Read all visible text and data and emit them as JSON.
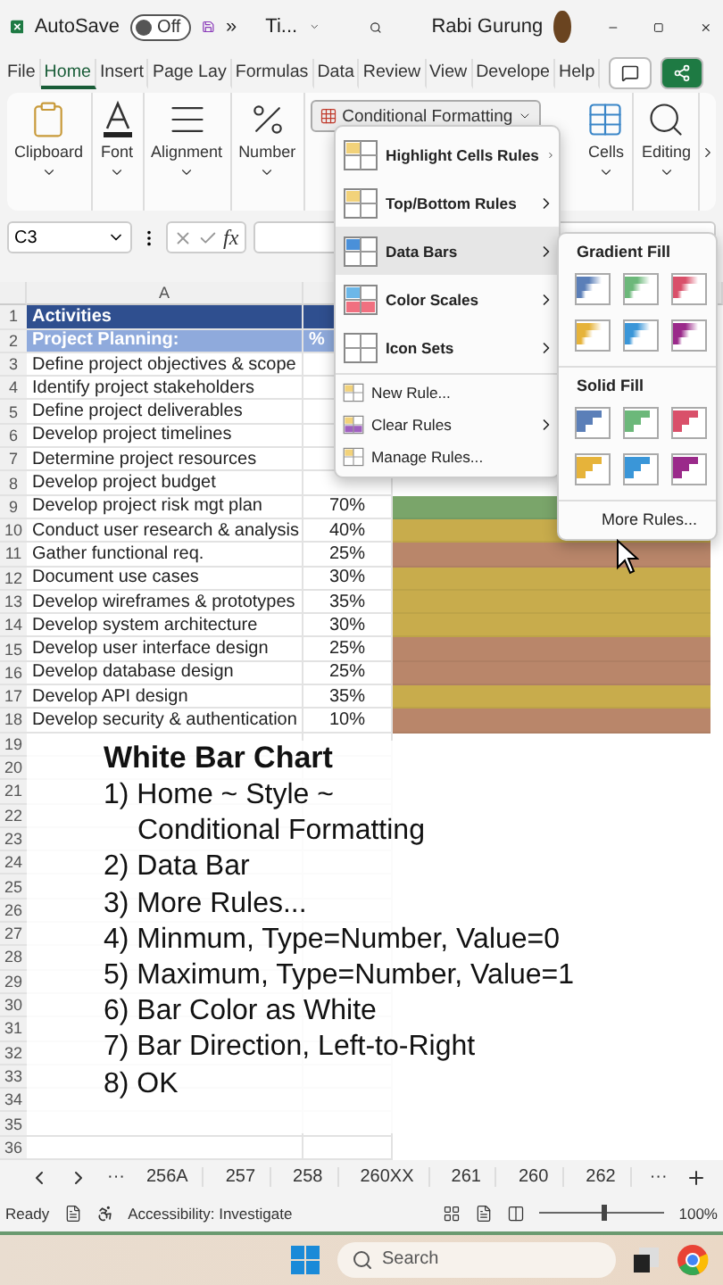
{
  "title_bar": {
    "autosave_label": "AutoSave",
    "autosave_on": false,
    "autosave_state": "Off",
    "more": "»",
    "file_name": "Ti...",
    "user": "Rabi Gurung"
  },
  "tabs": [
    {
      "label": "File",
      "selected": false
    },
    {
      "label": "Home",
      "selected": true
    },
    {
      "label": "Insert",
      "selected": false
    },
    {
      "label": "Page Lay",
      "selected": false
    },
    {
      "label": "Formulas",
      "selected": false
    },
    {
      "label": "Data",
      "selected": false
    },
    {
      "label": "Review",
      "selected": false
    },
    {
      "label": "View",
      "selected": false
    },
    {
      "label": "Develope",
      "selected": false
    },
    {
      "label": "Help",
      "selected": false
    }
  ],
  "ribbon": {
    "groups_left": [
      {
        "label": "Clipboard",
        "kind": "clipboard"
      },
      {
        "label": "Font",
        "kind": "font"
      },
      {
        "label": "Alignment",
        "kind": "alignment"
      },
      {
        "label": "Number",
        "kind": "number"
      }
    ],
    "conditional_formatting": "Conditional Formatting",
    "groups_right": [
      {
        "label": "Cells",
        "kind": "cells"
      },
      {
        "label": "Editing",
        "kind": "editing"
      }
    ]
  },
  "formula_bar": {
    "name_box": "C3",
    "fx": "fx"
  },
  "sheet": {
    "column_a": "A",
    "rows": [
      {
        "num": "1",
        "kind": "title",
        "activity": "Activities"
      },
      {
        "num": "2",
        "kind": "section",
        "activity": "Project Planning:",
        "percent": "%"
      },
      {
        "num": "3",
        "kind": "task",
        "activity": "Define project objectives & scope"
      },
      {
        "num": "4",
        "kind": "task",
        "activity": "Identify project stakeholders"
      },
      {
        "num": "5",
        "kind": "task",
        "activity": "Define project deliverables"
      },
      {
        "num": "6",
        "kind": "task",
        "activity": "Develop project timelines"
      },
      {
        "num": "7",
        "kind": "task",
        "activity": "Determine project resources"
      },
      {
        "num": "8",
        "kind": "task",
        "activity": "Develop project budget"
      },
      {
        "num": "9",
        "kind": "task",
        "activity": "Develop project risk mgt plan",
        "percent": "70%",
        "color": "#7aa56a"
      },
      {
        "num": "10",
        "kind": "task",
        "activity": "Conduct user research & analysis",
        "percent": "40%",
        "color": "#c8ac4c"
      },
      {
        "num": "11",
        "kind": "task",
        "activity": "Gather functional req.",
        "percent": "25%",
        "color": "#b9866a"
      },
      {
        "num": "12",
        "kind": "task",
        "activity": "Document use cases",
        "percent": "30%",
        "color": "#c8ac4c"
      },
      {
        "num": "13",
        "kind": "task",
        "activity": "Develop wireframes & prototypes",
        "percent": "35%",
        "color": "#c8ac4c"
      },
      {
        "num": "14",
        "kind": "task",
        "activity": "Develop system architecture",
        "percent": "30%",
        "color": "#c8ac4c"
      },
      {
        "num": "15",
        "kind": "task",
        "activity": "Develop user interface design",
        "percent": "25%",
        "color": "#b9866a"
      },
      {
        "num": "16",
        "kind": "task",
        "activity": "Develop database design",
        "percent": "25%",
        "color": "#b9866a"
      },
      {
        "num": "17",
        "kind": "task",
        "activity": "Develop API design",
        "percent": "35%",
        "color": "#c8ac4c"
      },
      {
        "num": "18",
        "kind": "task",
        "activity": "Develop security & authentication",
        "percent": "10%",
        "color": "#b9866a"
      },
      {
        "num": "19",
        "kind": "empty"
      },
      {
        "num": "20",
        "kind": "empty"
      },
      {
        "num": "21",
        "kind": "empty"
      },
      {
        "num": "22",
        "kind": "empty"
      },
      {
        "num": "23",
        "kind": "empty"
      },
      {
        "num": "24",
        "kind": "empty"
      },
      {
        "num": "25",
        "kind": "empty"
      },
      {
        "num": "26",
        "kind": "empty"
      },
      {
        "num": "27",
        "kind": "empty"
      },
      {
        "num": "28",
        "kind": "empty"
      },
      {
        "num": "29",
        "kind": "empty"
      },
      {
        "num": "30",
        "kind": "empty"
      },
      {
        "num": "31",
        "kind": "empty"
      },
      {
        "num": "32",
        "kind": "empty"
      },
      {
        "num": "33",
        "kind": "empty"
      },
      {
        "num": "34",
        "kind": "empty"
      },
      {
        "num": "35",
        "kind": "empty"
      },
      {
        "num": "36",
        "kind": "empty"
      }
    ]
  },
  "menu": {
    "items": [
      {
        "kind": "big",
        "label": "Highlight Cells Rules",
        "submenu": true,
        "selected": false
      },
      {
        "kind": "big",
        "label": "Top/Bottom Rules",
        "submenu": true,
        "selected": false
      },
      {
        "kind": "big",
        "label": "Data Bars",
        "submenu": true,
        "selected": true
      },
      {
        "kind": "big",
        "label": "Color Scales",
        "submenu": true,
        "selected": false
      },
      {
        "kind": "big",
        "label": "Icon Sets",
        "submenu": true,
        "selected": false
      },
      {
        "kind": "small",
        "label": "New Rule...",
        "submenu": false,
        "selected": false
      },
      {
        "kind": "small",
        "label": "Clear Rules",
        "submenu": true,
        "selected": false
      },
      {
        "kind": "small",
        "label": "Manage Rules...",
        "submenu": false,
        "selected": false
      }
    ]
  },
  "submenu": {
    "sections": [
      {
        "title": "Gradient Fill",
        "kind": "gradient",
        "swatches": [
          {
            "color": "#5b7fb8"
          },
          {
            "color": "#6cb87a"
          },
          {
            "color": "#d9506a"
          },
          {
            "color": "#e6b33a"
          },
          {
            "color": "#3a96d8"
          },
          {
            "color": "#9a2a8a"
          }
        ]
      },
      {
        "title": "Solid Fill",
        "kind": "solid",
        "swatches": [
          {
            "color": "#5b7fb8"
          },
          {
            "color": "#6cb87a"
          },
          {
            "color": "#d9506a"
          },
          {
            "color": "#e6b33a"
          },
          {
            "color": "#3a96d8"
          },
          {
            "color": "#9a2a8a"
          }
        ]
      }
    ],
    "more": "More Rules..."
  },
  "caption": {
    "title": "White Bar Chart",
    "steps": [
      [
        "1) Home ~ Style ~",
        "Conditional Formatting"
      ],
      [
        "2) Data Bar"
      ],
      [
        "3) More Rules..."
      ],
      [
        "4) Minmum, Type=Number, Value=0"
      ],
      [
        "5) Maximum, Type=Number, Value=1"
      ],
      [
        "6) Bar Color as White"
      ],
      [
        "7) Bar Direction, Left-to-Right"
      ],
      [
        "8) OK"
      ]
    ]
  },
  "sheet_tabs": {
    "more_left": "···",
    "tabs": [
      "256A",
      "257",
      "258",
      "260XX",
      "261",
      "260",
      "262"
    ],
    "more_right": "···"
  },
  "status_bar": {
    "ready": "Ready",
    "accessibility": "Accessibility: Investigate",
    "level": 0.5,
    "zoom": "100%"
  },
  "taskbar": {
    "search_placeholder": "Search"
  }
}
